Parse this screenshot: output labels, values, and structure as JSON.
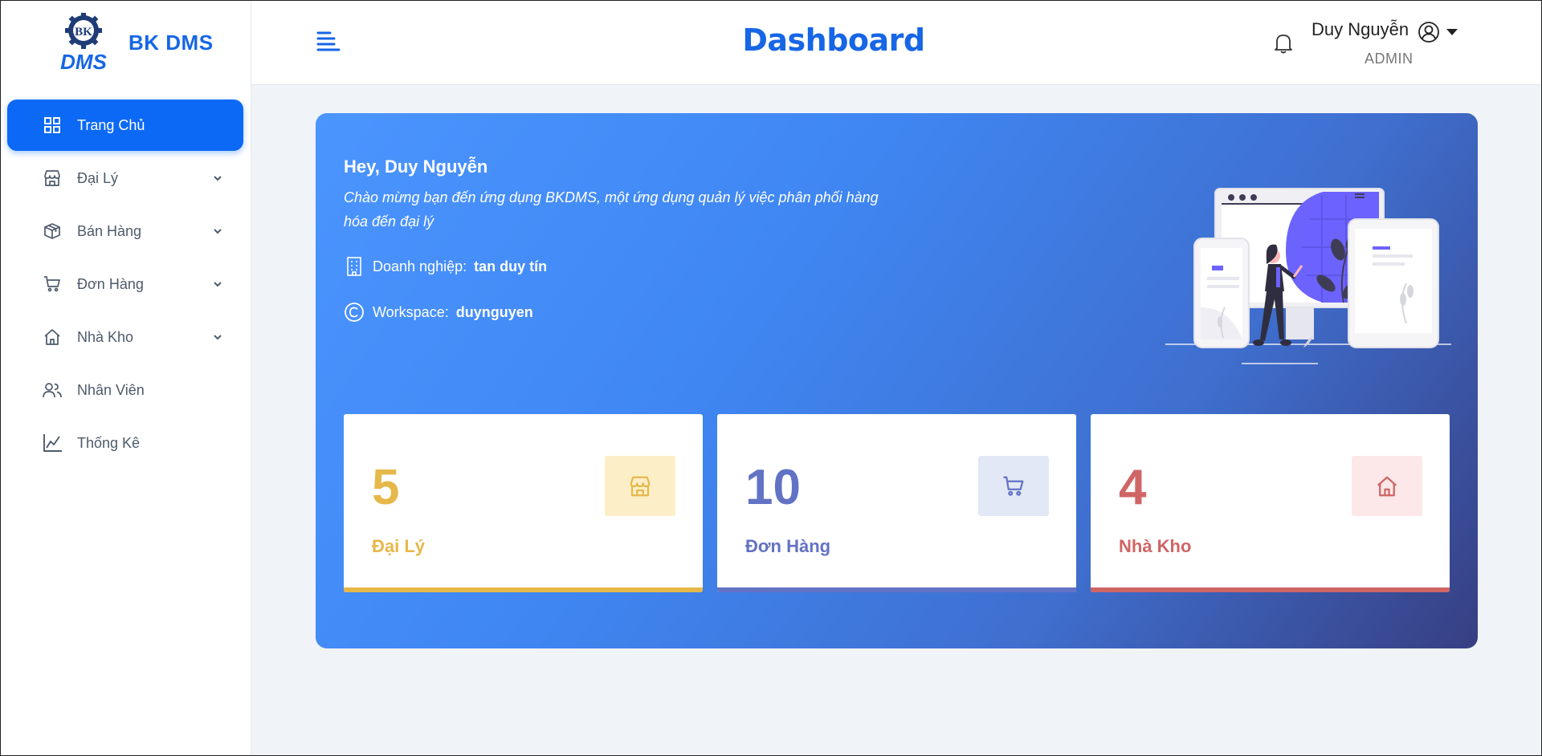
{
  "app": {
    "brand_name": "BK DMS",
    "logo_text_top": "BK",
    "logo_text_bottom": "DMS"
  },
  "sidebar": {
    "items": [
      {
        "label": "Trang Chủ",
        "icon": "grid-icon",
        "active": true,
        "has_submenu": false
      },
      {
        "label": "Đại Lý",
        "icon": "store-icon",
        "active": false,
        "has_submenu": true
      },
      {
        "label": "Bán Hàng",
        "icon": "box-icon",
        "active": false,
        "has_submenu": true
      },
      {
        "label": "Đơn Hàng",
        "icon": "cart-icon",
        "active": false,
        "has_submenu": true
      },
      {
        "label": "Nhà Kho",
        "icon": "home-icon",
        "active": false,
        "has_submenu": true
      },
      {
        "label": "Nhân Viên",
        "icon": "users-icon",
        "active": false,
        "has_submenu": false
      },
      {
        "label": "Thống Kê",
        "icon": "chart-line-icon",
        "active": false,
        "has_submenu": false
      }
    ]
  },
  "header": {
    "title": "Dashboard",
    "user_name": "Duy Nguyễn",
    "user_role": "ADMIN"
  },
  "hero": {
    "greeting": "Hey, Duy Nguyễn",
    "welcome": "Chào mừng bạn đến ứng dụng BKDMS, một ứng dụng quản lý việc phân phối hàng hóa đến đại lý",
    "company_label": "Doanh nghiệp:",
    "company_value": "tan duy tín",
    "workspace_label": "Workspace:",
    "workspace_value": "duynguyen"
  },
  "stats": [
    {
      "value": "5",
      "label": "Đại Lý",
      "icon": "store-icon",
      "color": "#e6b84a",
      "bg": "#fcefc8"
    },
    {
      "value": "10",
      "label": "Đơn Hàng",
      "icon": "cart-icon",
      "color": "#6272c4",
      "bg": "#e3e8f7"
    },
    {
      "value": "4",
      "label": "Nhà Kho",
      "icon": "home-icon",
      "color": "#d06565",
      "bg": "#fce8e8"
    }
  ],
  "colors": {
    "primary": "#1666e6",
    "active_nav": "#0b69f5"
  }
}
